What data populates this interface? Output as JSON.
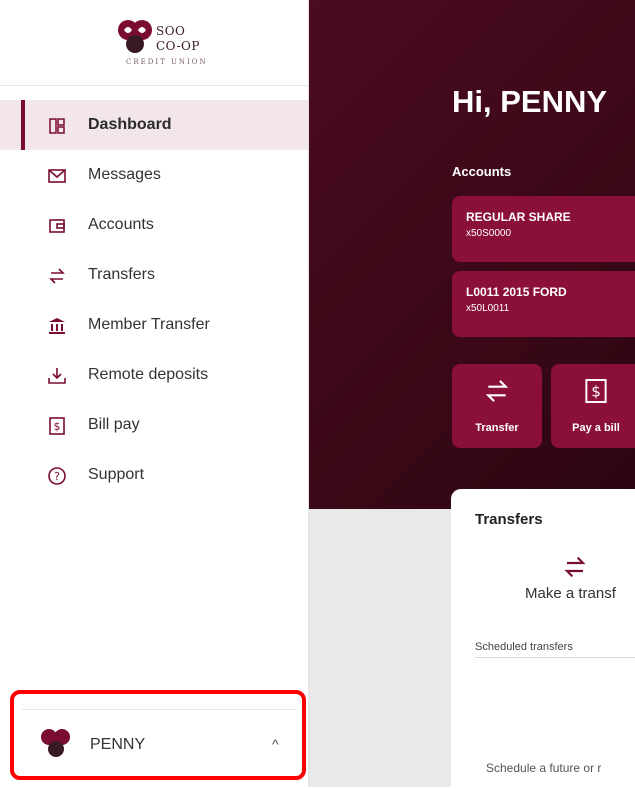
{
  "logo": {
    "line1": "SOO",
    "line2": "CO-OP",
    "line3": "CREDIT UNION"
  },
  "sidebar": {
    "items": [
      {
        "label": "Dashboard",
        "icon": "dashboard-icon",
        "active": true
      },
      {
        "label": "Messages",
        "icon": "mail-icon",
        "active": false
      },
      {
        "label": "Accounts",
        "icon": "wallet-icon",
        "active": false
      },
      {
        "label": "Transfers",
        "icon": "transfer-arrows-icon",
        "active": false
      },
      {
        "label": "Member Transfer",
        "icon": "bank-icon",
        "active": false
      },
      {
        "label": "Remote deposits",
        "icon": "deposit-icon",
        "active": false
      },
      {
        "label": "Bill pay",
        "icon": "bill-icon",
        "active": false
      },
      {
        "label": "Support",
        "icon": "help-icon",
        "active": false
      }
    ]
  },
  "user": {
    "name": "PENNY",
    "chevron": "^"
  },
  "main": {
    "greeting": "Hi, PENNY",
    "accounts_label": "Accounts",
    "accounts": [
      {
        "name": "REGULAR SHARE",
        "number": "x50S0000"
      },
      {
        "name": "L0011 2015 FORD",
        "number": "x50L0011"
      }
    ],
    "actions": [
      {
        "label": "Transfer",
        "icon": "transfer-arrows-icon"
      },
      {
        "label": "Pay a bill",
        "icon": "bill-icon"
      }
    ],
    "transfers_card": {
      "title": "Transfers",
      "make_text": "Make a transf",
      "scheduled_label": "Scheduled transfers",
      "footer_text": "Schedule a future or r"
    }
  },
  "colors": {
    "brand": "#7a0c33",
    "hero": "#3a0816",
    "card": "#8a0f3a",
    "highlight": "#ff0000"
  }
}
